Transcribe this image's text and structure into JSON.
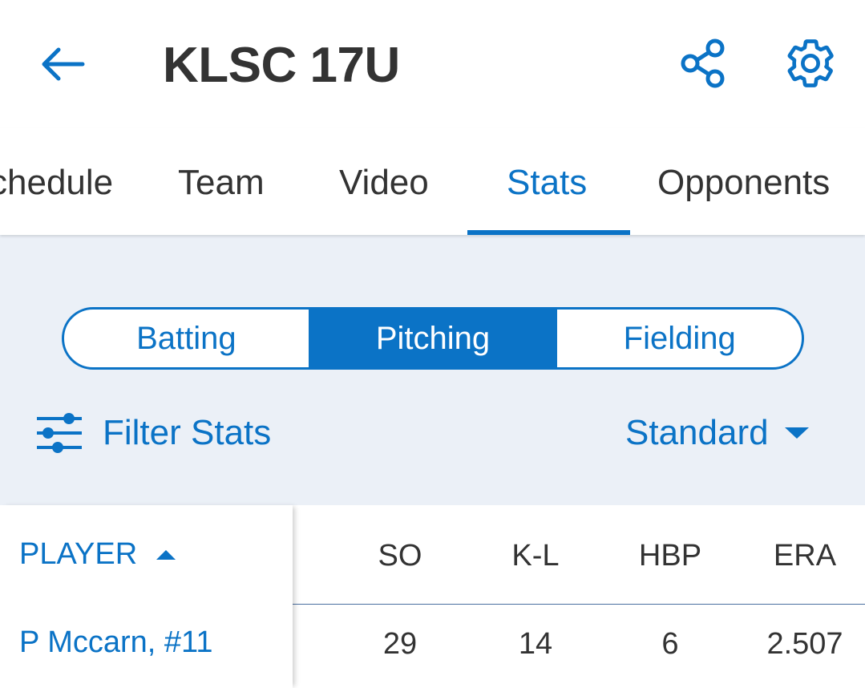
{
  "header": {
    "title": "KLSC 17U",
    "icons": {
      "back": "arrow-left-icon",
      "share": "share-icon",
      "settings": "gear-icon"
    }
  },
  "tabs": [
    {
      "label": "chedule",
      "active": false
    },
    {
      "label": "Team",
      "active": false
    },
    {
      "label": "Video",
      "active": false
    },
    {
      "label": "Stats",
      "active": true
    },
    {
      "label": "Opponents",
      "active": false
    }
  ],
  "segmented": {
    "batting": "Batting",
    "pitching": "Pitching",
    "fielding": "Fielding",
    "selected": "Pitching"
  },
  "filters": {
    "filter_label": "Filter Stats",
    "view_label": "Standard"
  },
  "table": {
    "player_header": "PLAYER",
    "columns": [
      "SO",
      "K-L",
      "HBP",
      "ERA"
    ],
    "rows": [
      {
        "player": "P Mccarn, #11",
        "values": [
          "29",
          "14",
          "6",
          "2.507"
        ]
      }
    ]
  },
  "colors": {
    "accent": "#0b73c6",
    "text": "#333333",
    "panel_bg": "#ebf0f7"
  }
}
